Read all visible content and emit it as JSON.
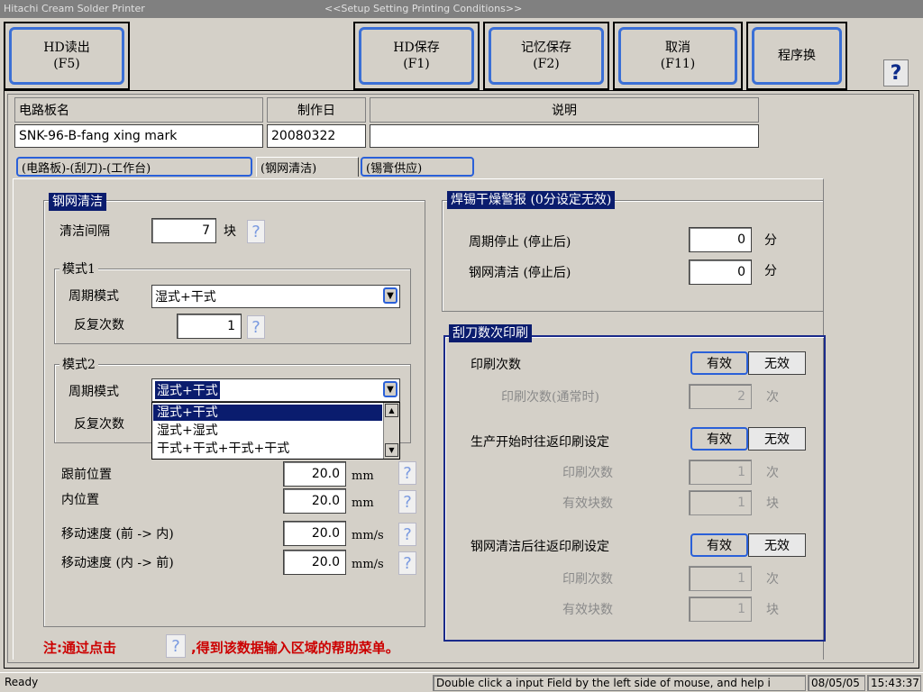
{
  "window": {
    "app_title": "Hitachi Cream Solder Printer",
    "screen_title": "<<Setup Setting Printing Conditions>>"
  },
  "toolbar": {
    "hd_read": {
      "line1": "HD读出",
      "line2": "(F5)"
    },
    "hd_save": {
      "line1": "HD保存",
      "line2": "(F1)"
    },
    "memory_save": {
      "line1": "记忆保存",
      "line2": "(F2)"
    },
    "cancel": {
      "line1": "取消",
      "line2": "(F11)"
    },
    "program_switch": {
      "line1": "程序换"
    },
    "help": "?"
  },
  "header": {
    "board_name_label": "电路板名",
    "date_label": "制作日",
    "desc_label": "说明",
    "board_name": "SNK-96-B-fang xing mark",
    "date": "20080322",
    "description": ""
  },
  "tabs": [
    {
      "label": "(电路板)-(刮刀)-(工作台)"
    },
    {
      "label": "(钢网清洁)"
    },
    {
      "label": "(锡膏供应)"
    }
  ],
  "cleaning": {
    "title": "钢网清洁",
    "interval_label": "清洁间隔",
    "interval_value": "7",
    "interval_unit": "块",
    "mode1": {
      "title": "模式1",
      "cycle_label": "周期模式",
      "cycle_value": "湿式+干式",
      "repeat_label": "反复次数",
      "repeat_value": "1"
    },
    "mode2": {
      "title": "模式2",
      "cycle_label": "周期模式",
      "cycle_value": "湿式+干式",
      "repeat_label": "反复次数",
      "options": [
        "湿式+干式",
        "湿式+湿式",
        "干式+干式+干式+干式"
      ]
    },
    "follow_pos_label": "跟前位置",
    "follow_pos_value": "20.0",
    "follow_pos_unit": "mm",
    "inner_pos_label": "内位置",
    "inner_pos_value": "20.0",
    "inner_pos_unit": "mm",
    "speed_fwd_label": "移动速度 (前  -> 内)",
    "speed_fwd_value": "20.0",
    "speed_fwd_unit": "mm/s",
    "speed_back_label": "移动速度 (内  -> 前)",
    "speed_back_value": "20.0",
    "speed_back_unit": "mm/s"
  },
  "dry_alarm": {
    "title": "焊锡干燥警报 (0分设定无效)",
    "cycle_stop_label": "周期停止 (停止后)",
    "cycle_stop_value": "0",
    "cycle_stop_unit": "分",
    "clean_stop_label": "钢网清洁 (停止后)",
    "clean_stop_value": "0",
    "clean_stop_unit": "分"
  },
  "squeegee": {
    "title": "刮刀数次印刷",
    "print_count_label": "印刷次数",
    "enable": "有效",
    "disable": "无效",
    "normal_count_label": "印刷次数(通常时)",
    "normal_count_value": "2",
    "count_unit": "次",
    "start_label": "生产开始时往返印刷设定",
    "start_count_label": "印刷次数",
    "start_count_value": "1",
    "start_blocks_label": "有效块数",
    "start_blocks_value": "1",
    "block_unit": "块",
    "after_clean_label": "钢网清洁后往返印刷设定",
    "after_count_label": "印刷次数",
    "after_count_value": "1",
    "after_blocks_label": "有效块数",
    "after_blocks_value": "1"
  },
  "note": {
    "prefix": "注:通过点击",
    "suffix": ",得到该数据输入区域的帮助菜单。",
    "qmark": "?"
  },
  "statusbar": {
    "status": "Ready",
    "hint": "Double click a input Field by the left side of mouse, and help i",
    "date": "08/05/05",
    "time": "15:43:37"
  }
}
